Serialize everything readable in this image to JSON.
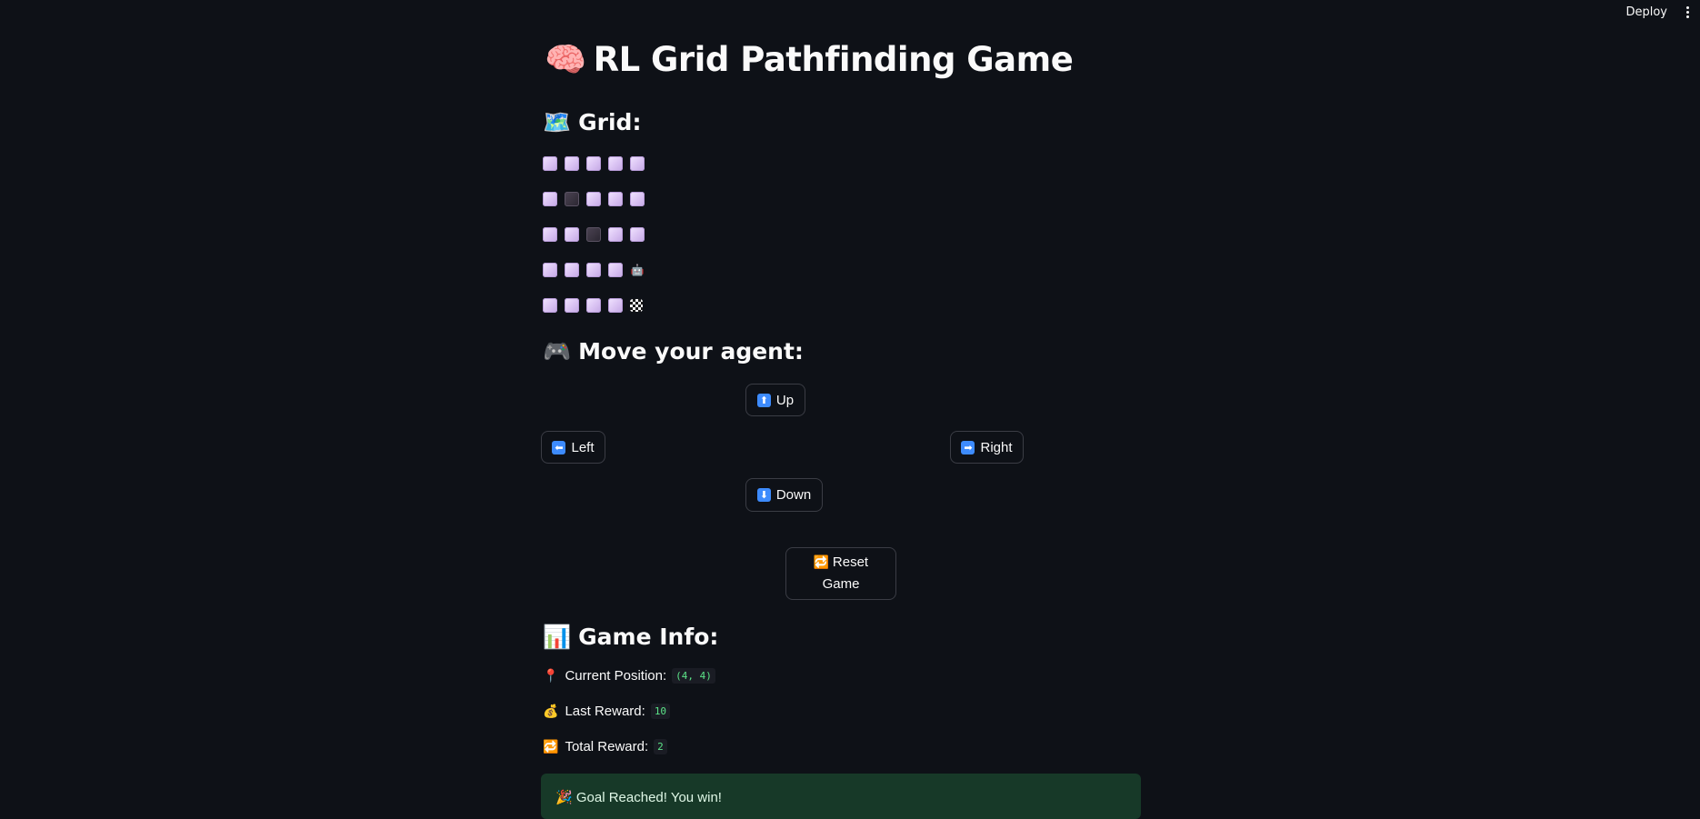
{
  "topbar": {
    "deploy_label": "Deploy"
  },
  "title": {
    "emoji": "🧠",
    "text": "RL Grid Pathfinding Game"
  },
  "grid_section": {
    "emoji": "🗺️",
    "heading": "Grid:",
    "rows": [
      [
        "lavender",
        "lavender",
        "lavender",
        "lavender",
        "lavender"
      ],
      [
        "lavender",
        "black",
        "lavender",
        "lavender",
        "lavender"
      ],
      [
        "lavender",
        "lavender",
        "black",
        "lavender",
        "lavender"
      ],
      [
        "lavender",
        "lavender",
        "lavender",
        "lavender",
        "agent"
      ],
      [
        "lavender",
        "lavender",
        "lavender",
        "lavender",
        "goal"
      ]
    ],
    "agent_glyph": "🤖"
  },
  "controls": {
    "emoji": "🎮",
    "heading": "Move your agent:",
    "up": {
      "icon": "⬆",
      "label": "Up"
    },
    "left": {
      "icon": "⬅",
      "label": "Left"
    },
    "right": {
      "icon": "➡",
      "label": "Right"
    },
    "down": {
      "icon": "⬇",
      "label": "Down"
    },
    "reset": {
      "icon": "🔁",
      "label_line1": "Reset",
      "label_line2": "Game"
    }
  },
  "game_info": {
    "emoji": "📊",
    "heading": "Game Info:",
    "current_position": {
      "emoji": "📍",
      "label": "Current Position:",
      "value": "(4, 4)"
    },
    "last_reward": {
      "emoji": "💰",
      "label": "Last Reward:",
      "value": "10"
    },
    "total_reward": {
      "emoji": "🔁",
      "label": "Total Reward:",
      "value": "2"
    }
  },
  "status": {
    "emoji": "🎉",
    "message": "Goal Reached! You win!"
  },
  "colors": {
    "background": "#0e1117",
    "text": "#fafafa",
    "code_text": "#5ce488",
    "success_bg": "#173928",
    "button_border": "#3b3d45",
    "icon_blue": "#3d8bfd"
  }
}
